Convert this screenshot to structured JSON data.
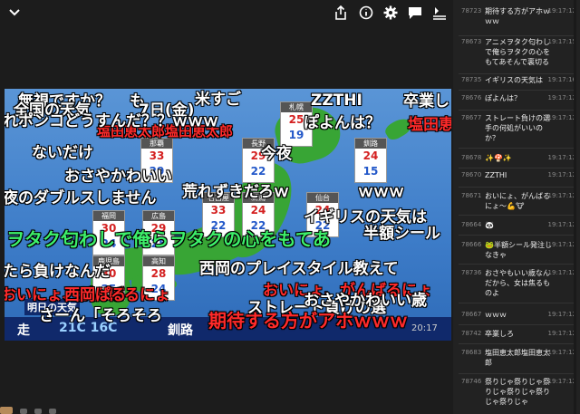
{
  "comments": [
    {
      "text": "無視ですか？",
      "color": "white"
    },
    {
      "text": "も",
      "color": "white"
    },
    {
      "text": "米すご",
      "color": "white"
    },
    {
      "text": "ZZTHI",
      "color": "white"
    },
    {
      "text": "卒業し",
      "color": "white"
    },
    {
      "text": "全国の天気",
      "color": "white"
    },
    {
      "text": "7日(金)",
      "color": "white"
    },
    {
      "text": "塩田恵太郎塩田恵太郎",
      "color": "red"
    },
    {
      "text": "ぽよんは？",
      "color": "white"
    },
    {
      "text": "塩田恵",
      "color": "red"
    },
    {
      "text": "れポンコどうすんだ？？ｗｗｗ",
      "color": "white"
    },
    {
      "text": "ないだけ",
      "color": "white"
    },
    {
      "text": "今夜",
      "color": "white"
    },
    {
      "text": "おさやかわいい",
      "color": "white"
    },
    {
      "text": "夜のダブルスしません",
      "color": "white"
    },
    {
      "text": "荒れずきだろｗ",
      "color": "white"
    },
    {
      "text": "ｗｗｗ",
      "color": "white"
    },
    {
      "text": "イギリスの天気は",
      "color": "white"
    },
    {
      "text": "ヲタク匂わしで俺らヲタクの心をもてあ",
      "color": "green"
    },
    {
      "text": "半額シール",
      "color": "white"
    },
    {
      "text": "たら負けなんだ",
      "color": "white"
    },
    {
      "text": "西岡のプレイスタイル教えて",
      "color": "white"
    },
    {
      "text": "おいにょ、がんばるにょ",
      "color": "red"
    },
    {
      "text": "おいにょ、がんばるにょ",
      "color": "red"
    },
    {
      "text": "西岡ぱる",
      "color": "red"
    },
    {
      "text": "ストレート負けの選",
      "color": "white"
    },
    {
      "text": "おさやかわいい歳",
      "color": "white"
    },
    {
      "text": "さーん「そろそろ",
      "color": "white"
    },
    {
      "text": "期待する方がアホｗｗｗ",
      "color": "red"
    }
  ],
  "weather_cards": [
    {
      "city": "札幌",
      "hi": "25",
      "lo": "19"
    },
    {
      "city": "釧路",
      "hi": "24",
      "lo": "15"
    },
    {
      "city": "那覇",
      "hi": "33",
      "lo": "29"
    },
    {
      "city": "仙台",
      "hi": "24",
      "lo": "22"
    },
    {
      "city": "福岡",
      "hi": "30",
      "lo": "24"
    },
    {
      "city": "広島",
      "hi": "29",
      "lo": "25"
    },
    {
      "city": "鹿児島",
      "hi": "30",
      "lo": "25"
    },
    {
      "city": "高知",
      "hi": "28",
      "lo": "24"
    },
    {
      "city": "新潟",
      "hi": "24",
      "lo": "22"
    },
    {
      "city": "名古屋",
      "hi": "33",
      "lo": "22"
    },
    {
      "city": "長野",
      "hi": "29",
      "lo": "22"
    }
  ],
  "bottom_ticker": {
    "left": "走",
    "temps": "21C 16C",
    "city": "釧路",
    "logo": "明日の天気",
    "time": "20:17"
  },
  "chat": [
    {
      "no": "78723",
      "time": "19:17:12",
      "text": "期待する方がアホｗｗｗ"
    },
    {
      "no": "78673",
      "time": "19:17:15",
      "text": "アニメヲタク匂わしで俺らヲタクの心をもてあそんで裏切る"
    },
    {
      "no": "78735",
      "time": "19:17:16",
      "text": "イギリスの天気は"
    },
    {
      "no": "78676",
      "time": "19:17:12",
      "text": "ぽよんは？"
    },
    {
      "no": "78677",
      "time": "19:17:12",
      "text": "ストレート負けの選手の何処がいいのか？"
    },
    {
      "no": "78678",
      "time": "19:17:12",
      "text": "✨🍄✨"
    },
    {
      "no": "78670",
      "time": "19:17:12",
      "text": "ZZTHI"
    },
    {
      "no": "78671",
      "time": "19:17:12",
      "text": "おいにょ、がんばるにょ～💪🐮"
    },
    {
      "no": "78664",
      "time": "19:17:12",
      "text": "🐼"
    },
    {
      "no": "78666",
      "time": "19:17:12",
      "text": "🐸半額シール発注しなきゃ"
    },
    {
      "no": "78736",
      "time": "19:17:12",
      "text": "おさやもいい歳なんだから、女は焦るものよ"
    },
    {
      "no": "78667",
      "time": "19:17:12",
      "text": "ｗｗｗ"
    },
    {
      "no": "78742",
      "time": "19:17:12",
      "text": "卒業しろ"
    },
    {
      "no": "78683",
      "time": "19:17:12",
      "text": "塩田恵太郎塩田恵太郎"
    },
    {
      "no": "78746",
      "time": "19:17:12",
      "text": "祭りじゃ祭りじゃ祭りじゃ祭りじゃ祭りじゃ祭りじゃ"
    }
  ]
}
